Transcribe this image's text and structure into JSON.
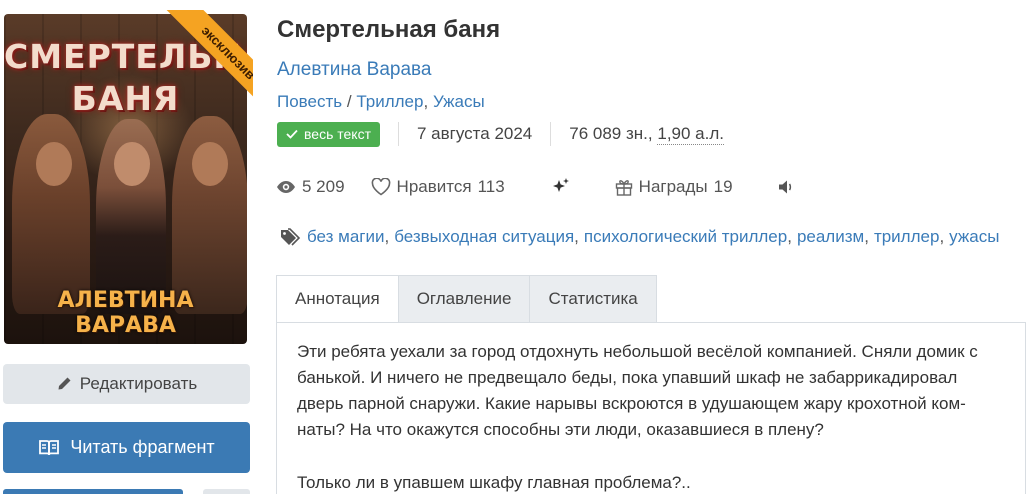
{
  "cover": {
    "title_line1": "СМЕРТЕЛЬНАЯ",
    "title_line2": "БАНЯ",
    "author": "АЛЕВТИНА ВАРАВА",
    "ribbon": "эксклюзив"
  },
  "sidebar": {
    "edit_label": "Редактировать",
    "read_label": "Читать фрагмент"
  },
  "book": {
    "title": "Смертельная баня",
    "author": "Алевтина Варава",
    "form": "Повесть",
    "genre_sep": "/",
    "genre1": "Триллер",
    "genre_comma": ",",
    "genre2": "Ужасы",
    "badge": "весь текст",
    "date": "7 августа 2024",
    "size_chars": "76 089 зн., ",
    "size_sheets": "1,90 а.л."
  },
  "stats": {
    "views": "5 209",
    "likes_label": "Нравится",
    "likes_count": "113",
    "awards_label": "Награды",
    "awards_count": "19"
  },
  "tags": [
    "без магии",
    "безвыходная ситуация",
    "психологический триллер",
    "реализм",
    "триллер",
    "ужасы"
  ],
  "tag_separator": ",",
  "tabs": {
    "annotation": "Аннотация",
    "contents": "Оглавление",
    "statistics": "Статистика"
  },
  "annotation": {
    "line1": "Эти ребята уехали за город отдохнуть небольшой весёлой компанией. Сняли домик с",
    "line2": "банькой. И ничего не предвещало беды, пока упавший шкаф не забаррикадировал",
    "line3": "дверь парной снаружи. Какие нарывы вскроются в удушающем жару крохотной ком-",
    "line4": "наты? На что окажутся способны эти люди, оказавшиеся в плену?",
    "line5": "Только ли в упавшем шкафу главная проблема?.."
  },
  "colors": {
    "link": "#3a7bb8",
    "badge_green": "#4caf50",
    "primary_button": "#3b7ab4",
    "ribbon": "#f5a322"
  }
}
